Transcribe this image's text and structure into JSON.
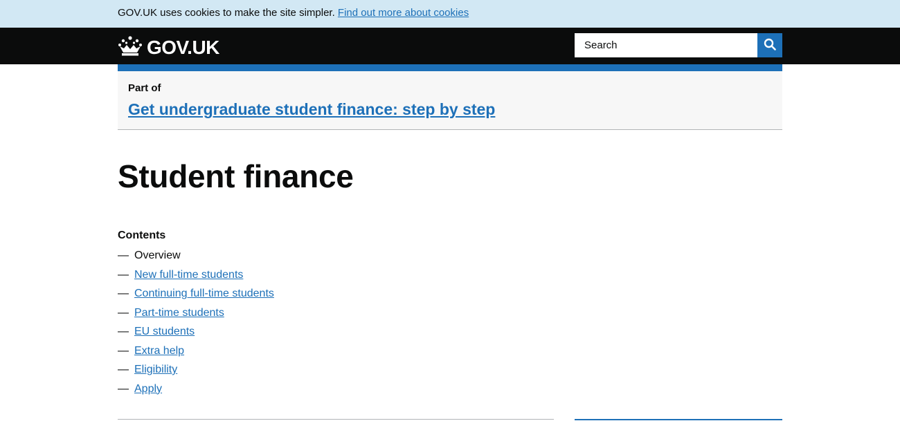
{
  "cookie_banner": {
    "text": "GOV.UK uses cookies to make the site simpler.",
    "link_label": "Find out more about cookies"
  },
  "header": {
    "logo_text": "GOV.UK",
    "logo_icon": "crown-icon",
    "search_placeholder": "Search",
    "search_icon": "search-icon"
  },
  "step_nav": {
    "part_of_label": "Part of",
    "link_label": "Get undergraduate student finance: step by step"
  },
  "page": {
    "title": "Student finance"
  },
  "contents": {
    "heading": "Contents",
    "dash": "—",
    "items": [
      {
        "label": "Overview",
        "current": true
      },
      {
        "label": "New full-time students",
        "current": false
      },
      {
        "label": "Continuing full-time students",
        "current": false
      },
      {
        "label": "Part-time students",
        "current": false
      },
      {
        "label": "EU students",
        "current": false
      },
      {
        "label": "Extra help",
        "current": false
      },
      {
        "label": "Eligibility",
        "current": false
      },
      {
        "label": "Apply",
        "current": false
      }
    ]
  },
  "colors": {
    "link": "#1d70b8",
    "header_bg": "#0b0c0c",
    "cookie_bg": "#d2e8f4",
    "step_nav_bg": "#f7f7f7"
  }
}
